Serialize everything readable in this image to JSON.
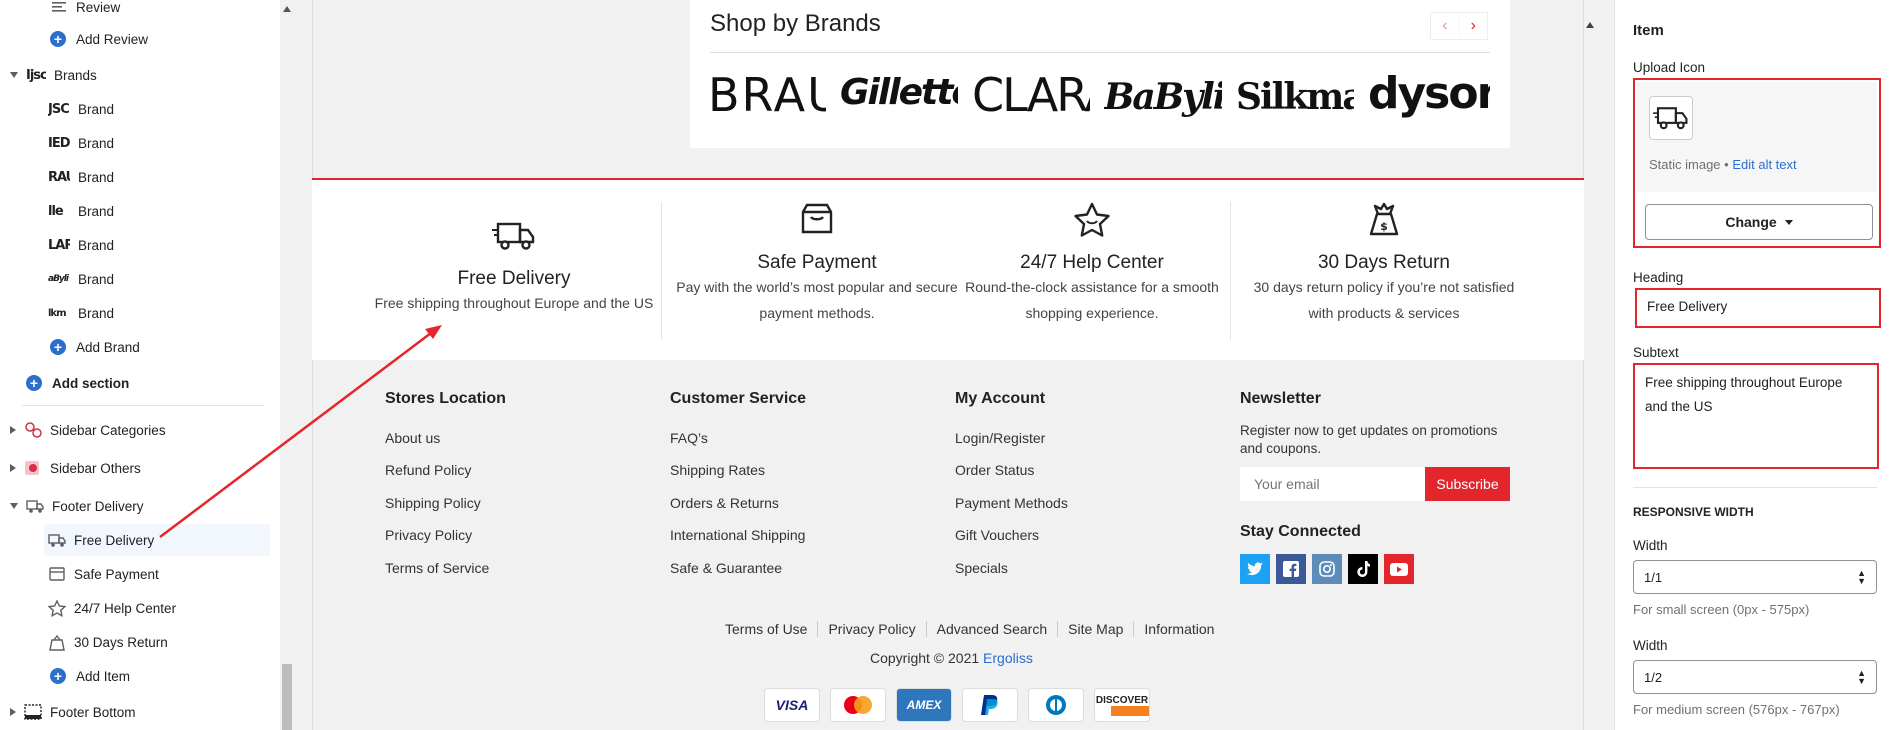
{
  "sidebar": {
    "review_label": "Review",
    "add_review": "Add Review",
    "brands_label": "Brands",
    "brand_items": [
      {
        "logo": "JSC",
        "label": "Brand"
      },
      {
        "logo": "IED",
        "label": "Brand"
      },
      {
        "logo": "RAU",
        "label": "Brand"
      },
      {
        "logo": "lle",
        "label": "Brand"
      },
      {
        "logo": "LAR",
        "label": "Brand"
      },
      {
        "logo": "aByli",
        "label": "Brand"
      },
      {
        "logo": "lkm",
        "label": "Brand"
      }
    ],
    "add_brand": "Add Brand",
    "add_section": "Add section",
    "sidebar_categories": "Sidebar Categories",
    "sidebar_others": "Sidebar Others",
    "footer_delivery": "Footer Delivery",
    "delivery_items": [
      "Free Delivery",
      "Safe Payment",
      "24/7 Help Center",
      "30 Days Return"
    ],
    "add_item": "Add Item",
    "footer_bottom": "Footer Bottom"
  },
  "preview": {
    "shop_by_brands": "Shop by Brands",
    "brand_logos": [
      "BRAUN",
      "Gillette",
      "CLARA",
      "BaByliss",
      "Silkman",
      "dyson"
    ],
    "features": [
      {
        "title": "Free Delivery",
        "lines": [
          "Free shipping throughout Europe and the US"
        ]
      },
      {
        "title": "Safe Payment",
        "lines": [
          "Pay with the world’s most popular and secure",
          "payment methods."
        ]
      },
      {
        "title": "24/7 Help Center",
        "lines": [
          "Round-the-clock assistance for a smooth",
          "shopping experience."
        ]
      },
      {
        "title": "30 Days Return",
        "lines": [
          "30 days return policy if you’re not satisfied",
          "with products & services"
        ]
      }
    ],
    "footer": {
      "stores": {
        "heading": "Stores Location",
        "links": [
          "About us",
          "Refund Policy",
          "Shipping Policy",
          "Privacy Policy",
          "Terms of Service"
        ]
      },
      "customer": {
        "heading": "Customer Service",
        "links": [
          "FAQ’s",
          "Shipping Rates",
          "Orders & Returns",
          "International Shipping",
          "Safe & Guarantee"
        ]
      },
      "account": {
        "heading": "My Account",
        "links": [
          "Login/Register",
          "Order Status",
          "Payment Methods",
          "Gift Vouchers",
          "Specials"
        ]
      },
      "newsletter": {
        "heading": "Newsletter",
        "text_line1": "Register now to get updates on promotions",
        "text_line2": "and coupons.",
        "placeholder": "Your email",
        "button": "Subscribe"
      },
      "stay_connected": "Stay Connected",
      "bottom_links": [
        "Terms of Use",
        "Privacy Policy",
        "Advanced Search",
        "Site Map",
        "Information"
      ],
      "copyright": "Copyright © 2021",
      "brand_link": "Ergoliss",
      "payments": [
        "VISA",
        "MasterCard",
        "AMEX",
        "PayPal",
        "Diners",
        "DISCOVER"
      ]
    }
  },
  "settings": {
    "title": "Item",
    "upload_icon_label": "Upload Icon",
    "static_image": "Static image",
    "edit_alt": "Edit alt text",
    "change_button": "Change",
    "heading_label": "Heading",
    "heading_value": "Free Delivery",
    "subtext_label": "Subtext",
    "subtext_value": "Free shipping throughout Europe and the US",
    "responsive_title": "RESPONSIVE WIDTH",
    "width_label_1": "Width",
    "width_value_1": "1/1",
    "width_help_1": "For small screen (0px - 575px)",
    "width_label_2": "Width",
    "width_value_2": "1/2",
    "width_help_2": "For medium screen (576px - 767px)"
  },
  "colors": {
    "accent_red": "#e3262b",
    "link_blue": "#2c6ecb"
  }
}
